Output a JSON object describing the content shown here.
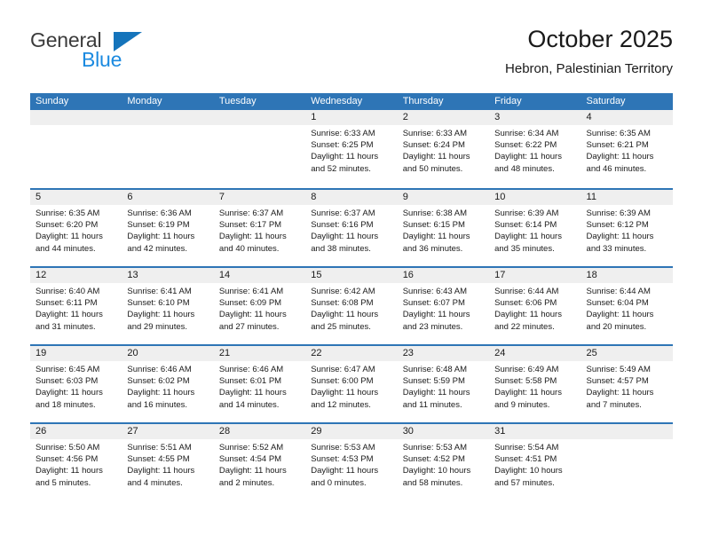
{
  "brand": {
    "name_top": "General",
    "name_bottom": "Blue",
    "accent_color": "#1b8ae0",
    "triangle_color": "#1574bb"
  },
  "header": {
    "title": "October 2025",
    "subtitle": "Hebron, Palestinian Territory"
  },
  "calendar": {
    "header_bg": "#2e75b6",
    "daynum_bg": "#efefef",
    "weekdays": [
      "Sunday",
      "Monday",
      "Tuesday",
      "Wednesday",
      "Thursday",
      "Friday",
      "Saturday"
    ],
    "weeks": [
      [
        {
          "day": "",
          "lines": []
        },
        {
          "day": "",
          "lines": []
        },
        {
          "day": "",
          "lines": []
        },
        {
          "day": "1",
          "lines": [
            "Sunrise: 6:33 AM",
            "Sunset: 6:25 PM",
            "Daylight: 11 hours",
            "and 52 minutes."
          ]
        },
        {
          "day": "2",
          "lines": [
            "Sunrise: 6:33 AM",
            "Sunset: 6:24 PM",
            "Daylight: 11 hours",
            "and 50 minutes."
          ]
        },
        {
          "day": "3",
          "lines": [
            "Sunrise: 6:34 AM",
            "Sunset: 6:22 PM",
            "Daylight: 11 hours",
            "and 48 minutes."
          ]
        },
        {
          "day": "4",
          "lines": [
            "Sunrise: 6:35 AM",
            "Sunset: 6:21 PM",
            "Daylight: 11 hours",
            "and 46 minutes."
          ]
        }
      ],
      [
        {
          "day": "5",
          "lines": [
            "Sunrise: 6:35 AM",
            "Sunset: 6:20 PM",
            "Daylight: 11 hours",
            "and 44 minutes."
          ]
        },
        {
          "day": "6",
          "lines": [
            "Sunrise: 6:36 AM",
            "Sunset: 6:19 PM",
            "Daylight: 11 hours",
            "and 42 minutes."
          ]
        },
        {
          "day": "7",
          "lines": [
            "Sunrise: 6:37 AM",
            "Sunset: 6:17 PM",
            "Daylight: 11 hours",
            "and 40 minutes."
          ]
        },
        {
          "day": "8",
          "lines": [
            "Sunrise: 6:37 AM",
            "Sunset: 6:16 PM",
            "Daylight: 11 hours",
            "and 38 minutes."
          ]
        },
        {
          "day": "9",
          "lines": [
            "Sunrise: 6:38 AM",
            "Sunset: 6:15 PM",
            "Daylight: 11 hours",
            "and 36 minutes."
          ]
        },
        {
          "day": "10",
          "lines": [
            "Sunrise: 6:39 AM",
            "Sunset: 6:14 PM",
            "Daylight: 11 hours",
            "and 35 minutes."
          ]
        },
        {
          "day": "11",
          "lines": [
            "Sunrise: 6:39 AM",
            "Sunset: 6:12 PM",
            "Daylight: 11 hours",
            "and 33 minutes."
          ]
        }
      ],
      [
        {
          "day": "12",
          "lines": [
            "Sunrise: 6:40 AM",
            "Sunset: 6:11 PM",
            "Daylight: 11 hours",
            "and 31 minutes."
          ]
        },
        {
          "day": "13",
          "lines": [
            "Sunrise: 6:41 AM",
            "Sunset: 6:10 PM",
            "Daylight: 11 hours",
            "and 29 minutes."
          ]
        },
        {
          "day": "14",
          "lines": [
            "Sunrise: 6:41 AM",
            "Sunset: 6:09 PM",
            "Daylight: 11 hours",
            "and 27 minutes."
          ]
        },
        {
          "day": "15",
          "lines": [
            "Sunrise: 6:42 AM",
            "Sunset: 6:08 PM",
            "Daylight: 11 hours",
            "and 25 minutes."
          ]
        },
        {
          "day": "16",
          "lines": [
            "Sunrise: 6:43 AM",
            "Sunset: 6:07 PM",
            "Daylight: 11 hours",
            "and 23 minutes."
          ]
        },
        {
          "day": "17",
          "lines": [
            "Sunrise: 6:44 AM",
            "Sunset: 6:06 PM",
            "Daylight: 11 hours",
            "and 22 minutes."
          ]
        },
        {
          "day": "18",
          "lines": [
            "Sunrise: 6:44 AM",
            "Sunset: 6:04 PM",
            "Daylight: 11 hours",
            "and 20 minutes."
          ]
        }
      ],
      [
        {
          "day": "19",
          "lines": [
            "Sunrise: 6:45 AM",
            "Sunset: 6:03 PM",
            "Daylight: 11 hours",
            "and 18 minutes."
          ]
        },
        {
          "day": "20",
          "lines": [
            "Sunrise: 6:46 AM",
            "Sunset: 6:02 PM",
            "Daylight: 11 hours",
            "and 16 minutes."
          ]
        },
        {
          "day": "21",
          "lines": [
            "Sunrise: 6:46 AM",
            "Sunset: 6:01 PM",
            "Daylight: 11 hours",
            "and 14 minutes."
          ]
        },
        {
          "day": "22",
          "lines": [
            "Sunrise: 6:47 AM",
            "Sunset: 6:00 PM",
            "Daylight: 11 hours",
            "and 12 minutes."
          ]
        },
        {
          "day": "23",
          "lines": [
            "Sunrise: 6:48 AM",
            "Sunset: 5:59 PM",
            "Daylight: 11 hours",
            "and 11 minutes."
          ]
        },
        {
          "day": "24",
          "lines": [
            "Sunrise: 6:49 AM",
            "Sunset: 5:58 PM",
            "Daylight: 11 hours",
            "and 9 minutes."
          ]
        },
        {
          "day": "25",
          "lines": [
            "Sunrise: 5:49 AM",
            "Sunset: 4:57 PM",
            "Daylight: 11 hours",
            "and 7 minutes."
          ]
        }
      ],
      [
        {
          "day": "26",
          "lines": [
            "Sunrise: 5:50 AM",
            "Sunset: 4:56 PM",
            "Daylight: 11 hours",
            "and 5 minutes."
          ]
        },
        {
          "day": "27",
          "lines": [
            "Sunrise: 5:51 AM",
            "Sunset: 4:55 PM",
            "Daylight: 11 hours",
            "and 4 minutes."
          ]
        },
        {
          "day": "28",
          "lines": [
            "Sunrise: 5:52 AM",
            "Sunset: 4:54 PM",
            "Daylight: 11 hours",
            "and 2 minutes."
          ]
        },
        {
          "day": "29",
          "lines": [
            "Sunrise: 5:53 AM",
            "Sunset: 4:53 PM",
            "Daylight: 11 hours",
            "and 0 minutes."
          ]
        },
        {
          "day": "30",
          "lines": [
            "Sunrise: 5:53 AM",
            "Sunset: 4:52 PM",
            "Daylight: 10 hours",
            "and 58 minutes."
          ]
        },
        {
          "day": "31",
          "lines": [
            "Sunrise: 5:54 AM",
            "Sunset: 4:51 PM",
            "Daylight: 10 hours",
            "and 57 minutes."
          ]
        },
        {
          "day": "",
          "lines": []
        }
      ]
    ]
  }
}
